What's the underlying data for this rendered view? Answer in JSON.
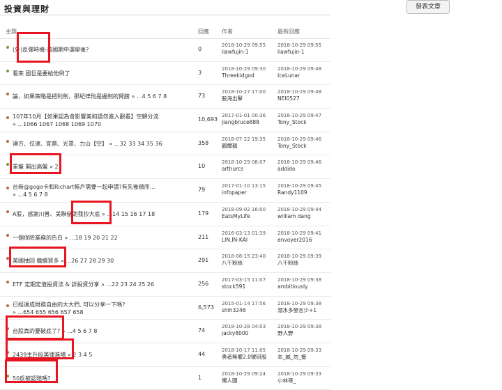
{
  "board": {
    "title": "投資與理財",
    "post_button": "發表文章"
  },
  "header": {
    "topic": "主題",
    "replies": "回應",
    "author": "作者",
    "last_reply": "最新回應"
  },
  "threads": [
    {
      "title": "(外)反彈時機-美國期中選舉後?",
      "pages": "",
      "replies": "0",
      "author_time": "2018-10-29 09:55",
      "author": "liawfujin-1",
      "last_time": "2018-10-29 09:55",
      "last_user": "liawfujin-1",
      "dot": "green"
    },
    {
      "title": "看來 國巨是要給他倒了",
      "pages": "",
      "replies": "3",
      "author_time": "2018-10-29 09:30",
      "author": "Threekidgod",
      "last_time": "2018-10-29 09:48",
      "last_user": "IceLunar",
      "dot": "green"
    },
    {
      "title": "論，如果策略是把利劍，那紀律則是握劍的臂膀",
      "pages": "» ...4 5 6 7 8",
      "replies": "73",
      "author_time": "2018-10-27 17:00",
      "author": "股海出擊",
      "last_time": "2018-10-29 09:48",
      "last_user": "NEI0527",
      "dot": "red"
    },
    {
      "title": "107年10月【如果認為會影響美和請勿進入觀看】空歸分流",
      "pages": "» ...1066 1067 1068 1069 1070",
      "replies": "10,693",
      "author_time": "2017-01-01 00:36",
      "author": "jiangbruce888",
      "last_time": "2018-10-29 09:47",
      "last_user": "Tony_Stock",
      "dot": "red"
    },
    {
      "title": "達方、位速、宜鼎、光罩、力山【空】",
      "pages": "» ...32 33 34 35 36",
      "replies": "358",
      "author_time": "2018-07-22 19:35",
      "author": "鵝爾鵝",
      "last_time": "2018-10-29 09:46",
      "last_user": "Tony_Stock",
      "dot": "red"
    },
    {
      "title": "軍盤 開出高盤",
      "pages": "» 2",
      "replies": "10",
      "author_time": "2018-10-29 08:07",
      "author": "arthurcs",
      "last_time": "2018-10-29 09:46",
      "last_user": "addido",
      "dot": "green"
    },
    {
      "title": "台新@gogo卡和Richart帳戶需要一起申請?有先後順序...",
      "pages": "» ...4 5 6 7 8",
      "replies": "79",
      "author_time": "2017-01-10 13:15",
      "author": "infopaper",
      "last_time": "2018-10-29 09:45",
      "last_user": "Randy1109",
      "dot": "red"
    },
    {
      "title": "A股，感謝川普、美聯儲助我抄大底",
      "pages": "» ...14 15 16 17 18",
      "replies": "179",
      "author_time": "2018-09-02 16:00",
      "author": "EatsMyLife",
      "last_time": "2018-10-29 09:44",
      "last_user": "william dang",
      "dot": "red"
    },
    {
      "title": "一個保險業務的告白",
      "pages": "» ...18 19 20 21 22",
      "replies": "211",
      "author_time": "2016-03-13 01:39",
      "author": "LIN,IN-KAI",
      "last_time": "2018-10-29 09:41",
      "last_user": "envoyer2016",
      "dot": "red"
    },
    {
      "title": "美國抽回 繼續買多",
      "pages": "» ...26 27 28 29 30",
      "replies": "291",
      "author_time": "2018-08-15 23:40",
      "author": "八千粉絲",
      "last_time": "2018-10-29 09:39",
      "last_user": "八千粉絲",
      "dot": "red"
    },
    {
      "title": "ETF 定期定值投資法 & 詳投資分享",
      "pages": "» ...22 23 24 25 26",
      "replies": "256",
      "author_time": "2017-03-15 11:07",
      "author": "stock591",
      "last_time": "2018-10-29 09:38",
      "last_user": "ambitiously",
      "dot": "red"
    },
    {
      "title": "已經達成財務自由的大大們, 可以分享一下嗎?",
      "pages": "» ...654 655 656 657 658",
      "replies": "6,573",
      "author_time": "2015-01-14 17:56",
      "author": "shih3246",
      "last_time": "2018-10-29 09:38",
      "last_user": "潛水多發言少+1",
      "dot": "red"
    },
    {
      "title": "台股真的要破底了?",
      "pages": "» ...4 5 6 7 8",
      "replies": "74",
      "author_time": "2018-10-28 04:03",
      "author": "jacky8000",
      "last_time": "2018-10-29 09:38",
      "last_user": "野人野",
      "dot": "red"
    },
    {
      "title": "2439主升段美律進場",
      "pages": "» 2 3 4 5",
      "replies": "44",
      "author_time": "2018-10-17 11:05",
      "author": "勇者無懼2.0號研股",
      "last_time": "2018-10-29 09:33",
      "last_user": "本_誠_勿_擾",
      "dot": "red"
    },
    {
      "title": "50反被認賠嗎?",
      "pages": "",
      "replies": "1",
      "author_time": "2018-10-29 09:24",
      "author": "懶人國",
      "last_time": "2018-10-29 09:33",
      "last_user": "小林哥_",
      "dot": "green"
    }
  ]
}
